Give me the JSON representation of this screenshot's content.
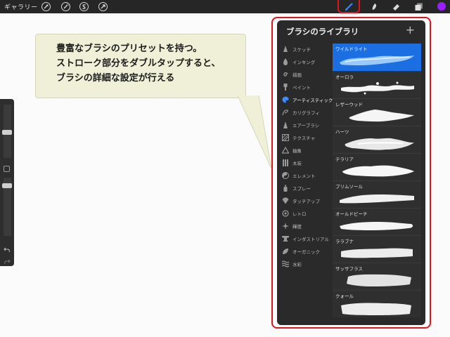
{
  "topbar": {
    "gallery_label": "ギャラリー",
    "left_tools": [
      "wrench-icon",
      "magic-wand-icon",
      "selection-icon",
      "transform-arrow-icon"
    ],
    "right_tools": [
      "brush-icon",
      "smudge-icon",
      "eraser-icon",
      "layers-icon"
    ],
    "color_swatch": "#9a1fff",
    "highlight_color": "#e0141c"
  },
  "callout": {
    "lines": [
      "豊富なブラシのプリセットを持つ。",
      "ストローク部分をダブルタップすると、",
      "ブラシの詳細な設定が行える"
    ],
    "background": "#f0f0d8"
  },
  "brush_library": {
    "title": "ブラシのライブラリ",
    "add_symbol": "+",
    "categories": [
      {
        "label": "スケッチ",
        "icon": "pencil-icon"
      },
      {
        "label": "インキング",
        "icon": "ink-drop-icon"
      },
      {
        "label": "描画",
        "icon": "spiral-icon"
      },
      {
        "label": "ペイント",
        "icon": "paint-brush-icon"
      },
      {
        "label": "アーティスティック",
        "icon": "palette-icon",
        "selected": true
      },
      {
        "label": "カリグラフィ",
        "icon": "calligraphy-icon"
      },
      {
        "label": "エアーブラシ",
        "icon": "airbrush-icon"
      },
      {
        "label": "テクスチャ",
        "icon": "texture-icon"
      },
      {
        "label": "抽象",
        "icon": "triangle-icon"
      },
      {
        "label": "木炭",
        "icon": "charcoal-icon"
      },
      {
        "label": "エレメント",
        "icon": "yin-yang-icon"
      },
      {
        "label": "スプレー",
        "icon": "spray-can-icon"
      },
      {
        "label": "タッチアップ",
        "icon": "touchup-icon"
      },
      {
        "label": "レトロ",
        "icon": "retro-icon"
      },
      {
        "label": "輝度",
        "icon": "sparkle-icon"
      },
      {
        "label": "インダストリアル",
        "icon": "anvil-icon"
      },
      {
        "label": "オーガニック",
        "icon": "leaf-icon"
      },
      {
        "label": "水彩",
        "icon": "water-icon"
      }
    ],
    "brushes": [
      {
        "label": "ワイルドライト",
        "selected": true
      },
      {
        "label": "オーロラ"
      },
      {
        "label": "レザーウッド"
      },
      {
        "label": "ハーツ"
      },
      {
        "label": "テラリア"
      },
      {
        "label": "プリムソール"
      },
      {
        "label": "オールドビーチ"
      },
      {
        "label": "ララブナ"
      },
      {
        "label": "サッサフラス"
      },
      {
        "label": "クォール"
      }
    ],
    "selected_color": "#1b6fe3"
  }
}
